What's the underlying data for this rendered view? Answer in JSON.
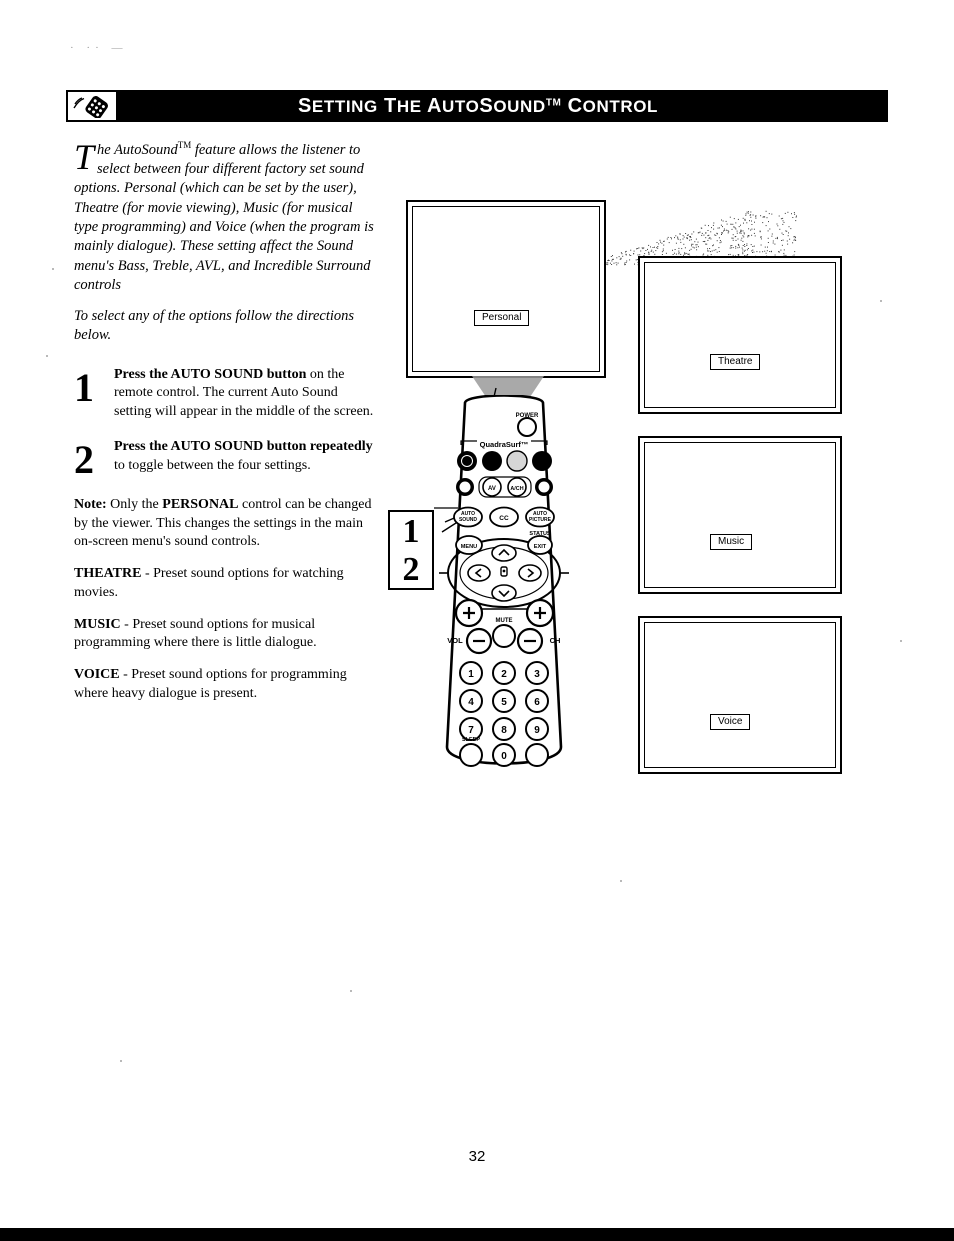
{
  "page": {
    "number": "32",
    "scan_marks": "· ·· ―"
  },
  "header": {
    "icon": "remote-control-icon",
    "title_parts": {
      "s": "S",
      "etting": "ETTING",
      "the_t": " T",
      "the_he": "HE ",
      "a": "A",
      "uto": "UTO",
      "s2": "S",
      "ound": "OUND",
      "tm": "TM",
      "c": " C",
      "ontrol": "ONTROL"
    },
    "title_plain": "SETTING THE AUTOSOUND™ CONTROL"
  },
  "intro": {
    "dropcap": "T",
    "text_line1": "he AutoSound",
    "tm": "TM",
    "text_rest": " feature allows the listener to select between four different factory set sound options. Personal (which can be set by the user), Theatre (for movie viewing), Music (for musical type programming) and Voice (when the program is mainly dialogue). These setting affect the Sound menu's Bass, Treble, AVL, and Incredible Surround controls",
    "text2": "To select any of the options follow the directions below."
  },
  "steps": [
    {
      "number": "1",
      "bold": "Press the AUTO  SOUND button",
      "rest": " on the remote control. The current Auto Sound setting will appear in the middle of the screen."
    },
    {
      "number": "2",
      "bold": "Press the AUTO  SOUND button repeatedly",
      "rest": " to toggle between the four settings."
    }
  ],
  "note": {
    "label": "Note:",
    "text_a": " Only the ",
    "emphasis": "PERSONAL",
    "text_b": " control can be changed by the viewer. This changes the settings in the main on-screen menu's sound controls."
  },
  "presets": [
    {
      "name": "THEATRE",
      "desc": " - Preset sound options for watching movies."
    },
    {
      "name": "MUSIC",
      "desc": " - Preset sound options for musical programming where there is little dialogue."
    },
    {
      "name": "VOICE",
      "desc": " - Preset sound options for programming where heavy dialogue is present."
    }
  ],
  "illustration": {
    "screens": [
      {
        "id": "main",
        "osd_label": "Personal"
      },
      {
        "id": "theatre",
        "osd_label": "Theatre"
      },
      {
        "id": "music",
        "osd_label": "Music"
      },
      {
        "id": "voice",
        "osd_label": "Voice"
      }
    ],
    "callout": {
      "one": "1",
      "two": "2"
    },
    "remote": {
      "power_label": "POWER",
      "quadrasurf_label": "QuadraSurf",
      "quadrasurf_tm": "TM",
      "row_buttons": [
        "AV",
        "A/CH"
      ],
      "function_buttons": [
        "AUTO SOUND",
        "CC",
        "AUTO PICTURE"
      ],
      "status_label": "STATUS",
      "menu_label": "MENU",
      "exit_label": "EXIT",
      "vol_label": "VOL",
      "mute_label": "MUTE",
      "ch_label": "CH",
      "plus": "+",
      "minus": "–",
      "sleep_label": "SLEEP",
      "keypad": [
        "1",
        "2",
        "3",
        "4",
        "5",
        "6",
        "7",
        "8",
        "9",
        "0"
      ]
    }
  },
  "colors": {
    "ink": "#000000",
    "paper": "#ffffff",
    "header_bg": "#000000",
    "header_text": "#ffffff"
  }
}
